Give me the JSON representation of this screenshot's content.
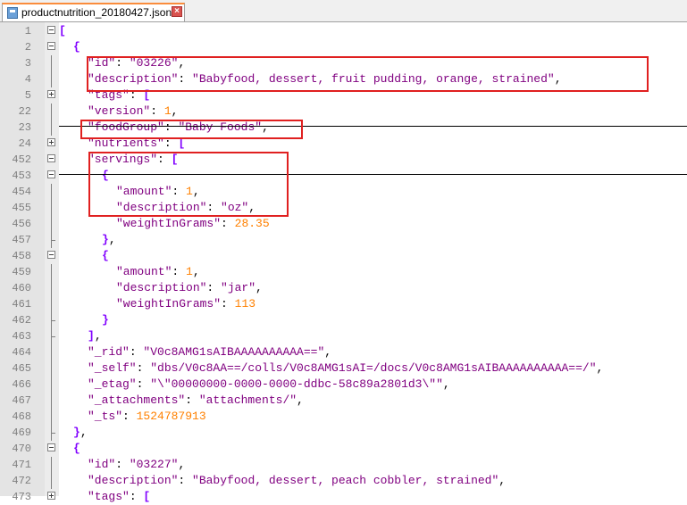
{
  "tab": {
    "filename": "productnutrition_20180427.json",
    "close_glyph": "×"
  },
  "lines": [
    {
      "n": "1",
      "fold": "minus",
      "indent": 0,
      "segs": [
        [
          "b",
          "["
        ]
      ]
    },
    {
      "n": "2",
      "fold": "minus",
      "indent": 1,
      "segs": [
        [
          "b",
          "{"
        ]
      ]
    },
    {
      "n": "3",
      "fold": "",
      "indent": 2,
      "segs": [
        [
          "s",
          "\"id\""
        ],
        [
          "p",
          ": "
        ],
        [
          "s",
          "\"03226\""
        ],
        [
          "p",
          ","
        ]
      ]
    },
    {
      "n": "4",
      "fold": "",
      "indent": 2,
      "segs": [
        [
          "s",
          "\"description\""
        ],
        [
          "p",
          ": "
        ],
        [
          "s",
          "\"Babyfood, dessert, fruit pudding, orange, strained\""
        ],
        [
          "p",
          ","
        ]
      ]
    },
    {
      "n": "5",
      "fold": "plus",
      "indent": 2,
      "segs": [
        [
          "s",
          "\"tags\""
        ],
        [
          "p",
          ": "
        ],
        [
          "b",
          "["
        ]
      ]
    },
    {
      "n": "22",
      "fold": "",
      "indent": 2,
      "segs": [
        [
          "s",
          "\"version\""
        ],
        [
          "p",
          ": "
        ],
        [
          "n",
          "1"
        ],
        [
          "p",
          ","
        ]
      ]
    },
    {
      "n": "23",
      "fold": "",
      "indent": 2,
      "segs": [
        [
          "s",
          "\"foodGroup\""
        ],
        [
          "p",
          ": "
        ],
        [
          "s",
          "\"Baby Foods\""
        ],
        [
          "p",
          ","
        ]
      ]
    },
    {
      "n": "24",
      "fold": "plus",
      "indent": 2,
      "segs": [
        [
          "s",
          "\"nutrients\""
        ],
        [
          "p",
          ": "
        ],
        [
          "b",
          "["
        ]
      ]
    },
    {
      "n": "452",
      "fold": "minus",
      "indent": 2,
      "segs": [
        [
          "s",
          "\"servings\""
        ],
        [
          "p",
          ": "
        ],
        [
          "b",
          "["
        ]
      ]
    },
    {
      "n": "453",
      "fold": "minus",
      "indent": 3,
      "segs": [
        [
          "b",
          "{"
        ]
      ]
    },
    {
      "n": "454",
      "fold": "",
      "indent": 4,
      "segs": [
        [
          "s",
          "\"amount\""
        ],
        [
          "p",
          ": "
        ],
        [
          "n",
          "1"
        ],
        [
          "p",
          ","
        ]
      ]
    },
    {
      "n": "455",
      "fold": "",
      "indent": 4,
      "segs": [
        [
          "s",
          "\"description\""
        ],
        [
          "p",
          ": "
        ],
        [
          "s",
          "\"oz\""
        ],
        [
          "p",
          ","
        ]
      ]
    },
    {
      "n": "456",
      "fold": "",
      "indent": 4,
      "segs": [
        [
          "s",
          "\"weightInGrams\""
        ],
        [
          "p",
          ": "
        ],
        [
          "n",
          "28.35"
        ]
      ]
    },
    {
      "n": "457",
      "fold": "end",
      "indent": 3,
      "segs": [
        [
          "b",
          "}"
        ],
        [
          "p",
          ","
        ]
      ]
    },
    {
      "n": "458",
      "fold": "minus",
      "indent": 3,
      "segs": [
        [
          "b",
          "{"
        ]
      ]
    },
    {
      "n": "459",
      "fold": "",
      "indent": 4,
      "segs": [
        [
          "s",
          "\"amount\""
        ],
        [
          "p",
          ": "
        ],
        [
          "n",
          "1"
        ],
        [
          "p",
          ","
        ]
      ]
    },
    {
      "n": "460",
      "fold": "",
      "indent": 4,
      "segs": [
        [
          "s",
          "\"description\""
        ],
        [
          "p",
          ": "
        ],
        [
          "s",
          "\"jar\""
        ],
        [
          "p",
          ","
        ]
      ]
    },
    {
      "n": "461",
      "fold": "",
      "indent": 4,
      "segs": [
        [
          "s",
          "\"weightInGrams\""
        ],
        [
          "p",
          ": "
        ],
        [
          "n",
          "113"
        ]
      ]
    },
    {
      "n": "462",
      "fold": "end",
      "indent": 3,
      "segs": [
        [
          "b",
          "}"
        ]
      ]
    },
    {
      "n": "463",
      "fold": "end",
      "indent": 2,
      "segs": [
        [
          "b",
          "]"
        ],
        [
          "p",
          ","
        ]
      ]
    },
    {
      "n": "464",
      "fold": "",
      "indent": 2,
      "segs": [
        [
          "s",
          "\"_rid\""
        ],
        [
          "p",
          ": "
        ],
        [
          "s",
          "\"V0c8AMG1sAIBAAAAAAAAAA==\""
        ],
        [
          "p",
          ","
        ]
      ]
    },
    {
      "n": "465",
      "fold": "",
      "indent": 2,
      "segs": [
        [
          "s",
          "\"_self\""
        ],
        [
          "p",
          ": "
        ],
        [
          "s",
          "\"dbs/V0c8AA==/colls/V0c8AMG1sAI=/docs/V0c8AMG1sAIBAAAAAAAAAA==/\""
        ],
        [
          "p",
          ","
        ]
      ]
    },
    {
      "n": "466",
      "fold": "",
      "indent": 2,
      "segs": [
        [
          "s",
          "\"_etag\""
        ],
        [
          "p",
          ": "
        ],
        [
          "s",
          "\"\\\"00000000-0000-0000-ddbc-58c89a2801d3\\\"\""
        ],
        [
          "p",
          ","
        ]
      ]
    },
    {
      "n": "467",
      "fold": "",
      "indent": 2,
      "segs": [
        [
          "s",
          "\"_attachments\""
        ],
        [
          "p",
          ": "
        ],
        [
          "s",
          "\"attachments/\""
        ],
        [
          "p",
          ","
        ]
      ]
    },
    {
      "n": "468",
      "fold": "",
      "indent": 2,
      "segs": [
        [
          "s",
          "\"_ts\""
        ],
        [
          "p",
          ": "
        ],
        [
          "n",
          "1524787913"
        ]
      ]
    },
    {
      "n": "469",
      "fold": "end",
      "indent": 1,
      "segs": [
        [
          "b",
          "}"
        ],
        [
          "p",
          ","
        ]
      ]
    },
    {
      "n": "470",
      "fold": "minus",
      "indent": 1,
      "segs": [
        [
          "b",
          "{"
        ]
      ]
    },
    {
      "n": "471",
      "fold": "",
      "indent": 2,
      "segs": [
        [
          "s",
          "\"id\""
        ],
        [
          "p",
          ": "
        ],
        [
          "s",
          "\"03227\""
        ],
        [
          "p",
          ","
        ]
      ]
    },
    {
      "n": "472",
      "fold": "",
      "indent": 2,
      "segs": [
        [
          "s",
          "\"description\""
        ],
        [
          "p",
          ": "
        ],
        [
          "s",
          "\"Babyfood, dessert, peach cobbler, strained\""
        ],
        [
          "p",
          ","
        ]
      ]
    },
    {
      "n": "473",
      "fold": "plus",
      "indent": 2,
      "segs": [
        [
          "s",
          "\"tags\""
        ],
        [
          "p",
          ": "
        ],
        [
          "b",
          "["
        ]
      ]
    }
  ],
  "colors": {
    "key": "#000080",
    "string": "#800080",
    "number": "#ff8000",
    "bracket": "#8000ff",
    "highlight_box": "#e02020"
  }
}
